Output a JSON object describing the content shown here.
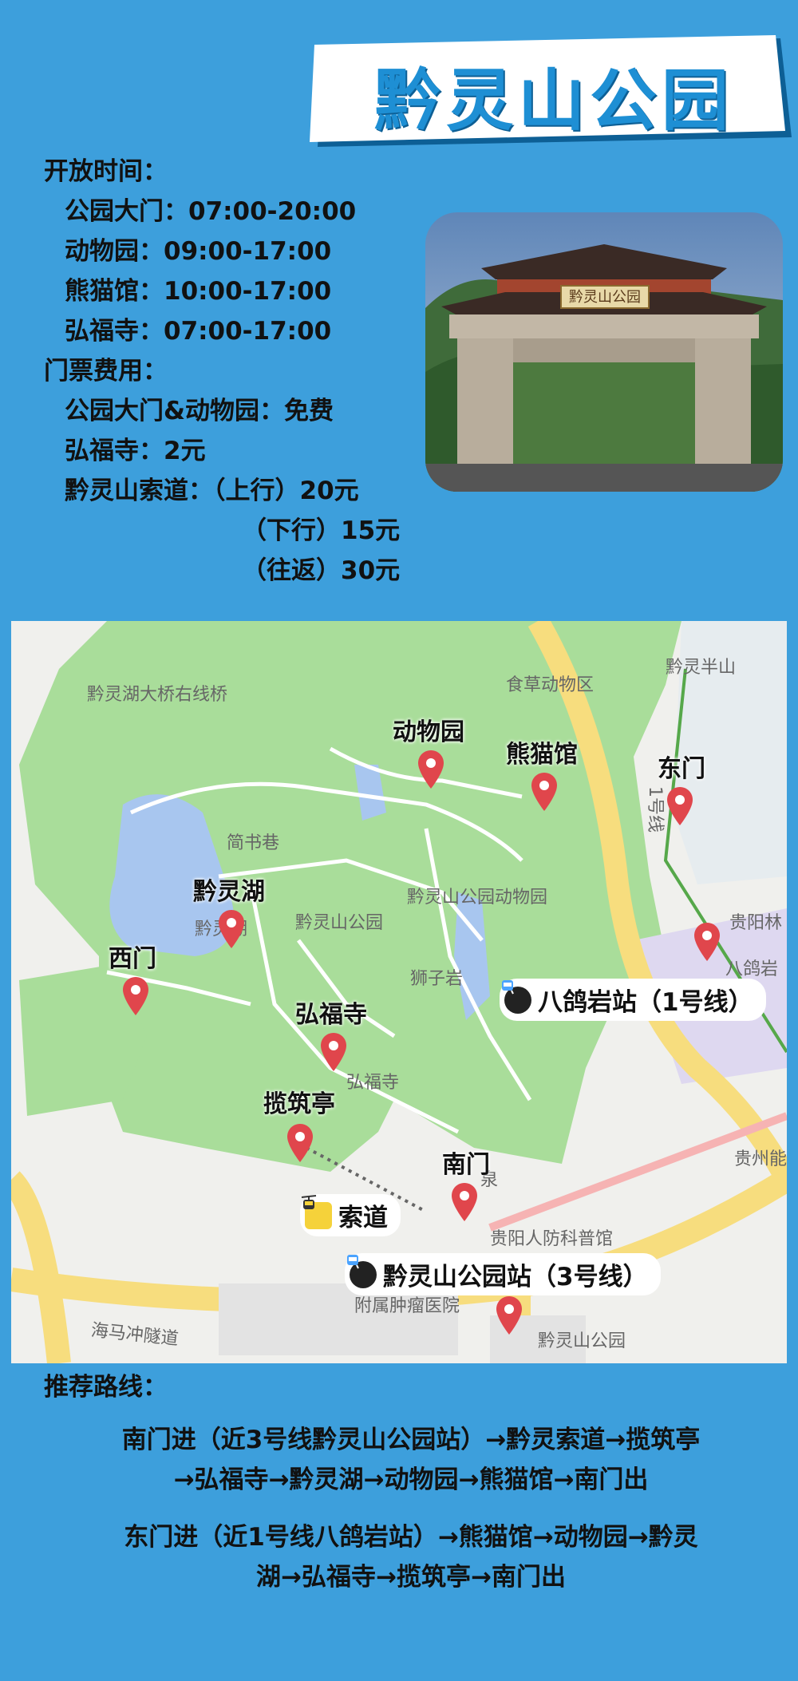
{
  "title": "黔灵山公园",
  "info": {
    "hours_heading": "开放时间：",
    "hours": [
      "公园大门：07:00-20:00",
      "动物园：09:00-17:00",
      "熊猫馆：10:00-17:00",
      "弘福寺：07:00-17:00"
    ],
    "ticket_heading": "门票费用：",
    "tickets": [
      "公园大门&动物园：免费",
      "弘福寺：2元",
      "黔灵山索道：（上行）20元"
    ],
    "ticket_extra": [
      "（下行）15元",
      "（往返）30元"
    ]
  },
  "photo": {
    "sign_text": "黔灵山公园"
  },
  "map": {
    "base_labels": [
      "黔灵湖大桥右线桥",
      "食草动物区",
      "黔灵半山",
      "简书巷",
      "黔灵湖",
      "黔灵山公园",
      "黔灵山公园动物园",
      "狮子岩",
      "弘福寺",
      "贵阳人防科普馆",
      "海马冲隧道",
      "黔灵山公园",
      "八鸽岩",
      "贵阳林",
      "贵州能",
      "1号线",
      "附属肿瘤医院",
      "泉"
    ],
    "pois": [
      "动物园",
      "熊猫馆",
      "东门",
      "黔灵湖",
      "西门",
      "弘福寺",
      "揽筑亭",
      "南门"
    ],
    "stations": [
      "八鸽岩站（1号线）",
      "黔灵山公园站（3号线）"
    ],
    "cableway": "索道",
    "colors": {
      "park": "#a9dd9a",
      "water": "#a8c6ef",
      "road": "#f7dd7e",
      "pin": "#e0464c"
    }
  },
  "routes": {
    "heading": "推荐路线：",
    "route1_line1": "南门进（近3号线黔灵山公园站）→黔灵索道→揽筑亭",
    "route1_line2": "→弘福寺→黔灵湖→动物园→熊猫馆→南门出",
    "route2_line1": "东门进（近1号线八鸽岩站）→熊猫馆→动物园→黔灵",
    "route2_line2": "湖→弘福寺→揽筑亭→南门出"
  }
}
